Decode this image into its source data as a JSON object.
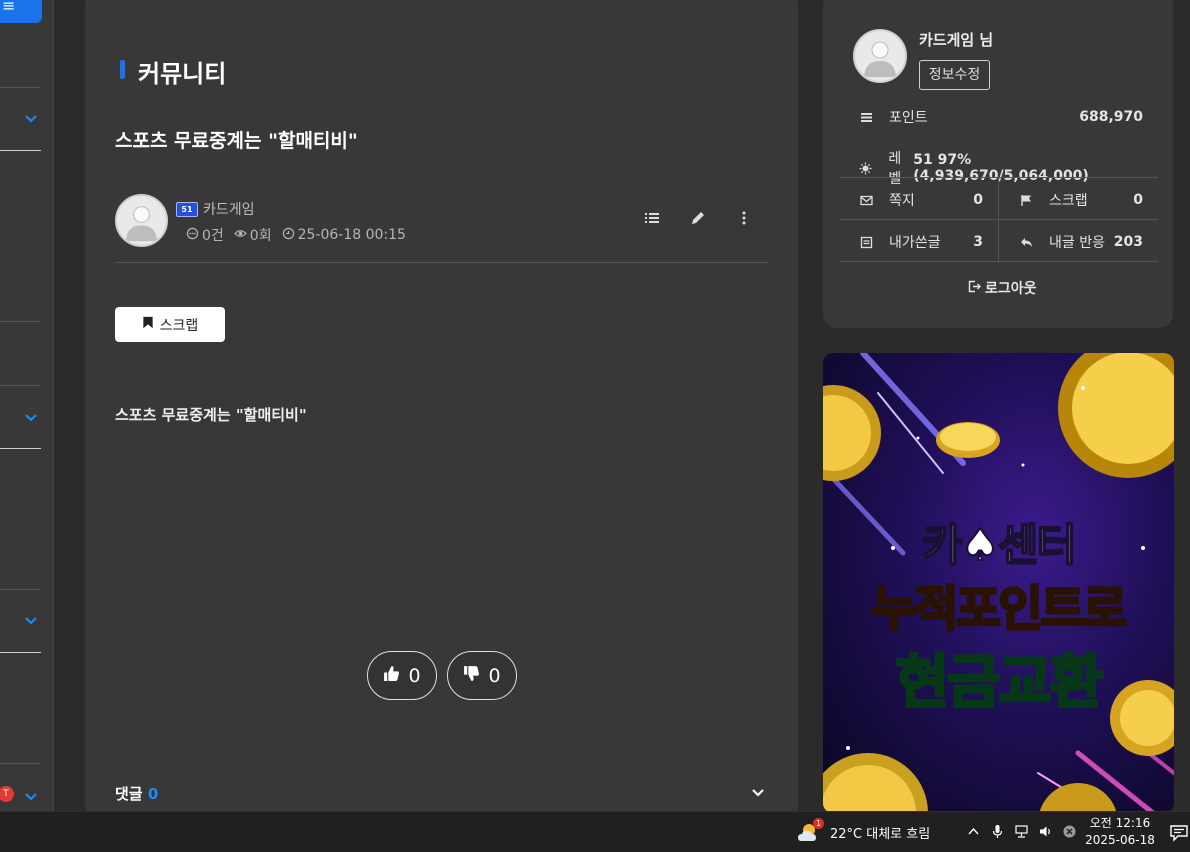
{
  "sidebar": {
    "menu_icon": "menu-icon",
    "badge_text": "T"
  },
  "board": {
    "title": "커뮤니티"
  },
  "post": {
    "title": "스포츠 무료중계는 \"할매티비\"",
    "author": "카드게임",
    "comments_count": "0건",
    "views": "0회",
    "date": "25-06-18 00:15",
    "scrap_label": "스크랩",
    "body": "스포츠 무료중계는 \"할매티비\"",
    "likes": "0",
    "dislikes": "0",
    "comment_label": "댓글",
    "comment_count": "0"
  },
  "user": {
    "name": "카드게임 님",
    "edit_label": "정보수정",
    "point_label": "포인트",
    "point_value": "688,970",
    "level_label": "레벨",
    "level_value": "51 97% (4,939,670/5,064,000)",
    "memo_label": "쪽지",
    "memo_value": "0",
    "scrap_label": "스크랩",
    "scrap_value": "0",
    "mypost_label": "내가쓴글",
    "mypost_value": "3",
    "reaction_label": "내글 반응",
    "reaction_value": "203",
    "logout_label": "로그아웃"
  },
  "ad": {
    "line1": "카♠센터",
    "line2": "누적포인트로",
    "line3": "현금교환"
  },
  "taskbar": {
    "weather": "22°C  대체로 흐림",
    "weather_badge": "1",
    "time": "오전 12:16",
    "date": "2025-06-18"
  },
  "colors": {
    "accent": "#1a73e8",
    "page_bg": "#2b2b2b",
    "card_bg": "#383838"
  }
}
